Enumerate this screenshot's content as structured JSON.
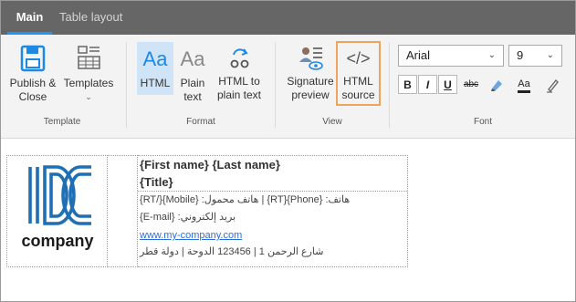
{
  "tabs": [
    {
      "label": "Main",
      "active": true
    },
    {
      "label": "Table layout",
      "active": false
    }
  ],
  "ribbon": {
    "template_group": {
      "label": "Template",
      "publish_close": "Publish &\nClose",
      "templates": "Templates"
    },
    "format_group": {
      "label": "Format",
      "html": "HTML",
      "plain_text": "Plain text",
      "html_to_plain": "HTML to plain text",
      "html_icon_text": "Aa",
      "plain_icon_text": "Aa"
    },
    "view_group": {
      "label": "View",
      "signature_preview": "Signature preview",
      "html_source": "HTML source",
      "html_source_icon": "</>"
    },
    "font_group": {
      "label": "Font",
      "font_family": "Arial",
      "font_size": "9",
      "bold": "B",
      "italic": "I",
      "underline": "U",
      "strikethrough": "abc",
      "font_color_icon": "Aa"
    }
  },
  "signature": {
    "logo_text": "company",
    "name_line": "{First name} {Last name}",
    "title_line": "{Title}",
    "phone_line": "هاتف: {Phone}{RT} | هاتف محمول: {Mobile}{/RT}",
    "email_line": "بريد إلكتروني: {E-mail}",
    "website": "www.my-company.com",
    "address_line": "شارع الرحمن 1 | 123456 الدوحة | دولة قطر"
  },
  "colors": {
    "tabbar": "#666666",
    "accent_blue": "#2196f3",
    "selected_bg": "#cfe5f7",
    "highlight_outline": "#f0a45a",
    "logo_blue": "#1f6fb5",
    "link": "#2a6edc"
  }
}
